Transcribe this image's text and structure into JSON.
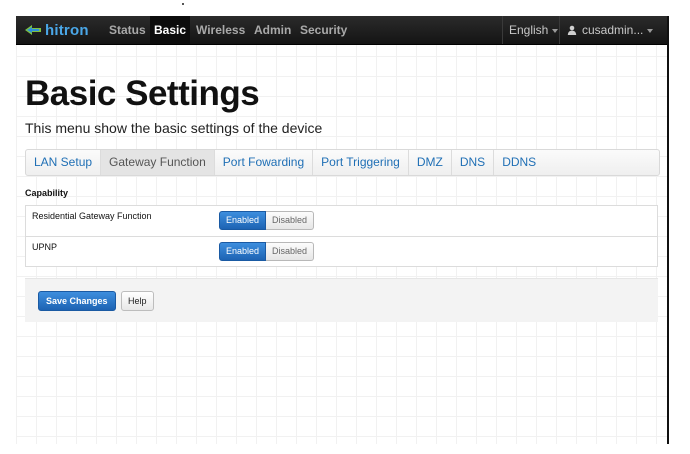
{
  "brand": {
    "name": "hitron"
  },
  "nav": {
    "items": [
      {
        "label": "Status",
        "active": false
      },
      {
        "label": "Basic",
        "active": true
      },
      {
        "label": "Wireless",
        "active": false
      },
      {
        "label": "Admin",
        "active": false
      },
      {
        "label": "Security",
        "active": false
      }
    ],
    "language": "English",
    "user": "cusadmin..."
  },
  "header": {
    "title": "Basic Settings",
    "subtitle": "This menu show the basic settings of the device"
  },
  "tabs": [
    {
      "label": "LAN Setup",
      "active": false
    },
    {
      "label": "Gateway Function",
      "active": true
    },
    {
      "label": "Port Fowarding",
      "active": false
    },
    {
      "label": "Port Triggering",
      "active": false
    },
    {
      "label": "DMZ",
      "active": false
    },
    {
      "label": "DNS",
      "active": false
    },
    {
      "label": "DDNS",
      "active": false
    }
  ],
  "capability": {
    "section_label": "Capability",
    "rows": [
      {
        "label": "Residential Gateway Function",
        "enabled_label": "Enabled",
        "disabled_label": "Disabled",
        "value": "Enabled"
      },
      {
        "label": "UPNP",
        "enabled_label": "Enabled",
        "disabled_label": "Disabled",
        "value": "Enabled"
      }
    ]
  },
  "actions": {
    "save_label": "Save Changes",
    "help_label": "Help"
  },
  "colors": {
    "accent": "#1d63b3",
    "navbar": "#1e1e1e",
    "brand": "#4aa7e8",
    "tab_link": "#1f6fb5"
  }
}
